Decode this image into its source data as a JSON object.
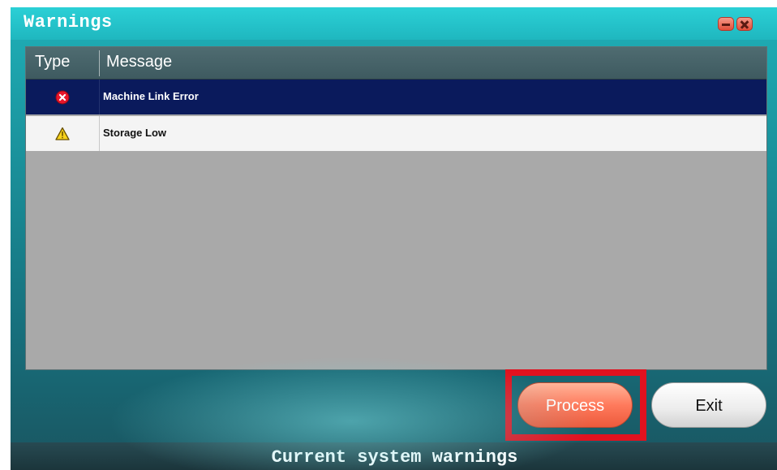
{
  "window": {
    "title": "Warnings",
    "minimize_icon": "minimize-icon",
    "close_icon": "close-icon"
  },
  "table": {
    "columns": [
      "Type",
      "Message"
    ],
    "rows": [
      {
        "type_icon": "error-icon",
        "message": "Machine Link Error",
        "selected": true
      },
      {
        "type_icon": "warning-icon",
        "message": "Storage Low",
        "selected": false
      }
    ]
  },
  "buttons": {
    "process_label": "Process",
    "exit_label": "Exit"
  },
  "status": {
    "text": "Current system warnings"
  },
  "colors": {
    "title_bar": "#1fb7bf",
    "selected_row": "#0a1a5c",
    "process_button": "#ff7a5c",
    "highlight_box": "#e1121f"
  }
}
